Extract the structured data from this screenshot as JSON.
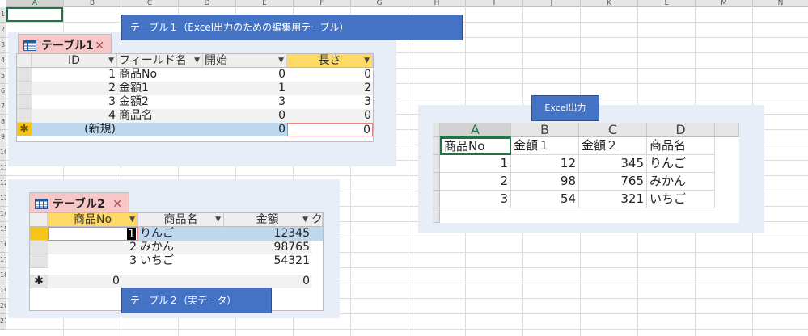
{
  "excel": {
    "columns": [
      "A",
      "B",
      "C",
      "D",
      "E",
      "F",
      "G",
      "H",
      "I",
      "J",
      "K",
      "L",
      "M",
      "N"
    ],
    "rows": [
      "1",
      "2",
      "3",
      "4",
      "5",
      "6",
      "7",
      "8",
      "9",
      "10",
      "11",
      "12",
      "13",
      "14",
      "15",
      "16",
      "17",
      "18",
      "19",
      "20",
      "21"
    ]
  },
  "banner1": "テーブル１（Excel出力のための編集用テーブル）",
  "banner2": "テーブル２（実データ）",
  "banner3": "Excel出力",
  "table1": {
    "tab": "テーブル1",
    "close": "✕",
    "headers": [
      "ID",
      "フィールド名",
      "開始",
      "長さ"
    ],
    "rows": [
      [
        "1",
        "商品No",
        "0",
        "0"
      ],
      [
        "2",
        "金額1",
        "1",
        "2"
      ],
      [
        "3",
        "金額2",
        "3",
        "3"
      ],
      [
        "4",
        "商品名",
        "0",
        "0"
      ]
    ],
    "new_row": [
      "(新規)",
      "",
      "0",
      "0"
    ],
    "new_marker": "✱"
  },
  "table2": {
    "tab": "テーブル2",
    "close": "✕",
    "headers": [
      "商品No",
      "商品名",
      "金額",
      "ク"
    ],
    "rows": [
      [
        "1",
        "りんご",
        "12345"
      ],
      [
        "2",
        "みかん",
        "98765"
      ],
      [
        "3",
        "いちご",
        "54321"
      ]
    ],
    "new_row": [
      "0",
      "",
      "0"
    ],
    "new_marker": "✱"
  },
  "excel_out": {
    "columns": [
      "A",
      "B",
      "C",
      "D"
    ],
    "rows": [
      [
        "商品No",
        "金額１",
        "金額２",
        "商品名"
      ],
      [
        "1",
        "12",
        "345",
        "りんご"
      ],
      [
        "2",
        "98",
        "765",
        "みかん"
      ],
      [
        "3",
        "54",
        "321",
        "いちご"
      ]
    ]
  },
  "colors": {
    "banner": "#4472c4",
    "panel": "#e8eef8",
    "tab": "#f7c6c6",
    "selected_row": "#bdd7ee",
    "highlight_header": "#ffd966",
    "excel_green": "#217346"
  }
}
